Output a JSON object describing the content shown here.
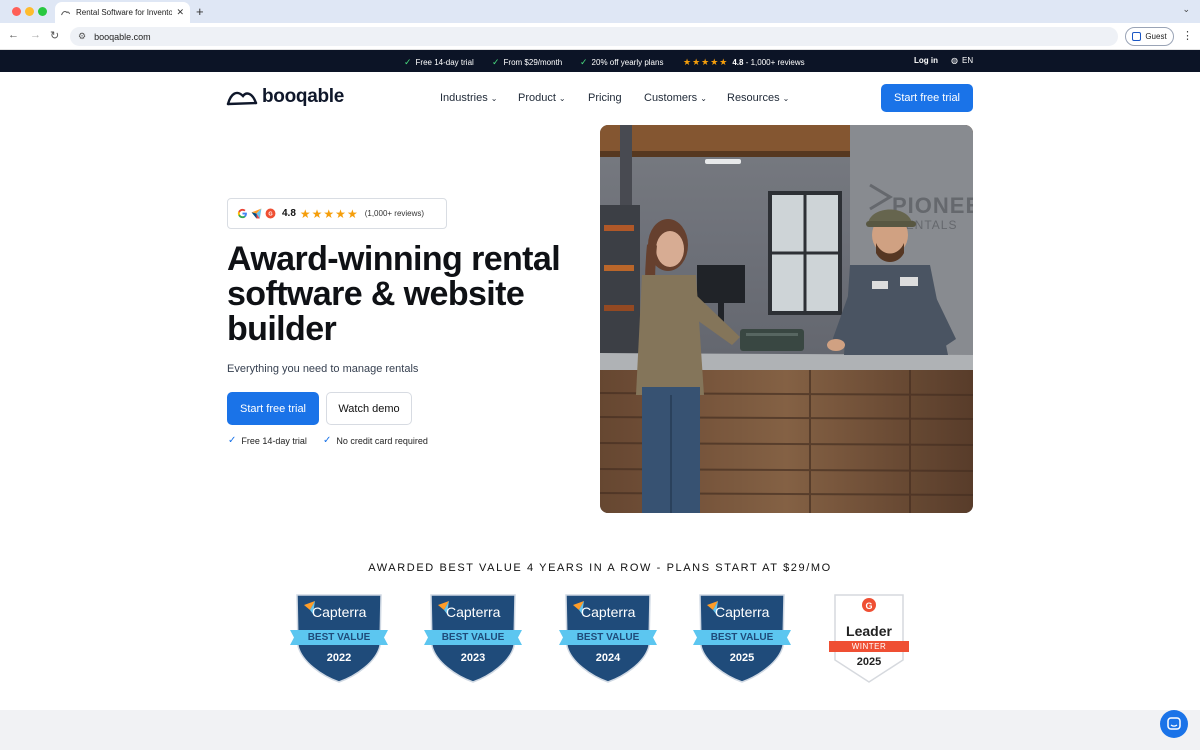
{
  "browser": {
    "tab_title": "Rental Software for Inventory",
    "tab_close": "✕",
    "new_tab": "+",
    "url": "booqable.com",
    "profile_label": "Guest"
  },
  "announcement": {
    "items": [
      "Free 14-day trial",
      "From $29/month",
      "20% off yearly plans"
    ],
    "rating_score": "4.8",
    "rating_text": "- 1,000+ reviews",
    "login": "Log in",
    "language": "EN"
  },
  "header": {
    "logo_text": "booqable",
    "nav": [
      "Industries",
      "Product",
      "Pricing",
      "Customers",
      "Resources"
    ],
    "cta": "Start free trial"
  },
  "hero": {
    "rating_score": "4.8",
    "rating_count": "(1,000+ reviews)",
    "title": "Award-winning rental software & website builder",
    "subtitle": "Everything you need to manage rentals",
    "primary_cta": "Start free trial",
    "secondary_cta": "Watch demo",
    "checks": [
      "Free 14-day trial",
      "No credit card required"
    ],
    "image_sign": "PIONEE RENTALS"
  },
  "awards": {
    "heading": "AWARDED BEST VALUE 4 YEARS IN A ROW - PLANS START AT $29/MO",
    "capterra": [
      {
        "brand": "Capterra",
        "label": "BEST VALUE",
        "year": "2022"
      },
      {
        "brand": "Capterra",
        "label": "BEST VALUE",
        "year": "2023"
      },
      {
        "brand": "Capterra",
        "label": "BEST VALUE",
        "year": "2024"
      },
      {
        "brand": "Capterra",
        "label": "BEST VALUE",
        "year": "2025"
      }
    ],
    "g2": {
      "title": "Leader",
      "season": "WINTER",
      "year": "2025"
    }
  },
  "colors": {
    "accent": "#1a73e8",
    "topbar": "#0c1426",
    "capterra_navy": "#1f4b7a",
    "capterra_ribbon": "#5cc6f0",
    "g2_red": "#ef4f33"
  }
}
